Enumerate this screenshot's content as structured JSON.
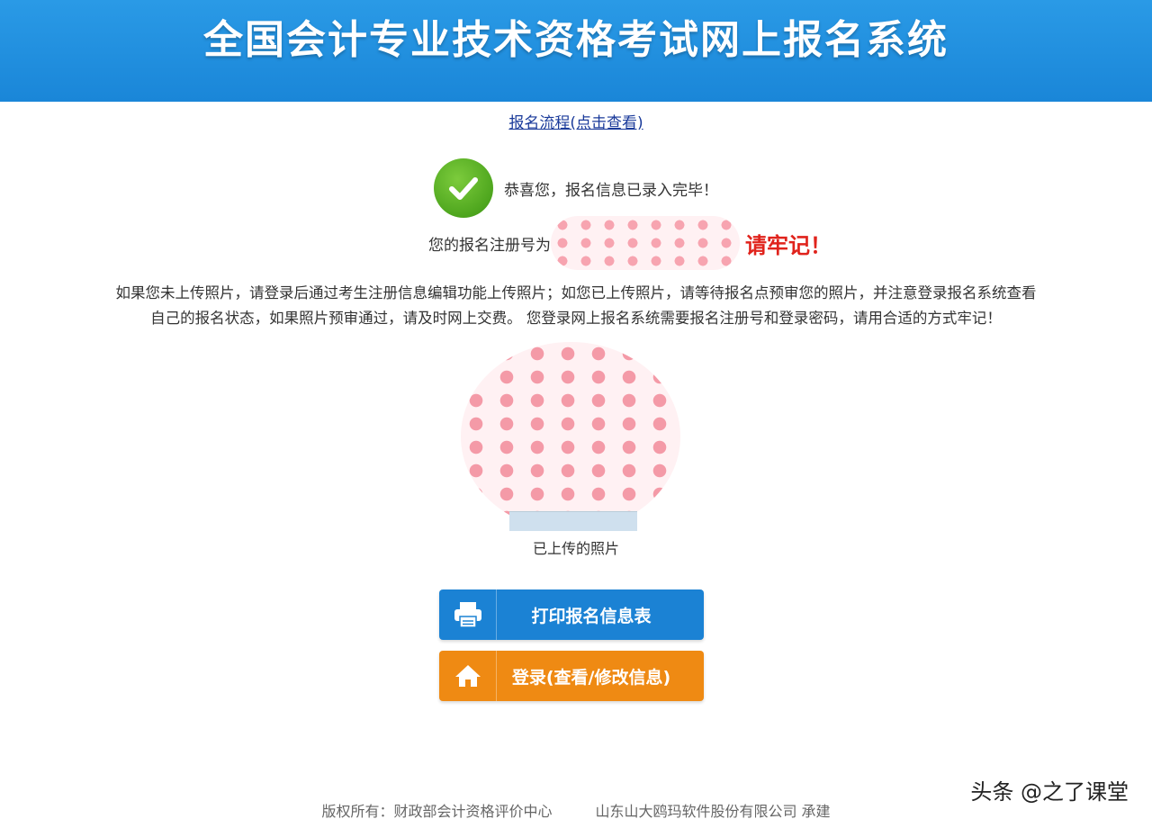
{
  "header": {
    "title": "全国会计专业技术资格考试网上报名系统",
    "bg_color": "#1a86d8"
  },
  "flow_link": {
    "label": "报名流程(点击查看)"
  },
  "success": {
    "icon": "check-icon",
    "message": "恭喜您，报名信息已录入完毕！"
  },
  "registration": {
    "label": "您的报名注册号为",
    "remember": "请牢记！"
  },
  "notice": {
    "line1": "如果您未上传照片，请登录后通过考生注册信息编辑功能上传照片；如您已上传照片，请等待报名点预审您的照片，并注意登录报名系统查看",
    "line2": "自己的报名状态，如果照片预审通过，请及时网上交费。 您登录网上报名系统需要报名注册号和登录密码，请用合适的方式牢记！"
  },
  "photo": {
    "caption": "已上传的照片"
  },
  "buttons": {
    "print": {
      "label": "打印报名信息表",
      "icon": "printer-icon",
      "color": "#1b82d4"
    },
    "login": {
      "label": "登录(查看/修改信息)",
      "icon": "home-icon",
      "color": "#ef8a13"
    }
  },
  "footer": {
    "copyright": "版权所有：财政部会计资格评价中心",
    "builder": "山东山大鸥玛软件股份有限公司 承建"
  },
  "watermark": {
    "text": "头条 @之了课堂"
  }
}
